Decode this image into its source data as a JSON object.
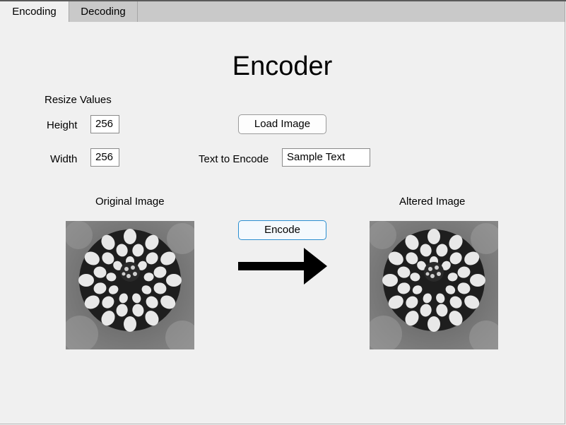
{
  "tabs": [
    {
      "label": "Encoding",
      "active": true
    },
    {
      "label": "Decoding",
      "active": false
    }
  ],
  "title": "Encoder",
  "resize": {
    "heading": "Resize Values",
    "height_label": "Height",
    "height_value": "256",
    "width_label": "Width",
    "width_value": "256"
  },
  "load_image_label": "Load Image",
  "text_to_encode": {
    "label": "Text to Encode",
    "value": "Sample Text"
  },
  "original_image_label": "Original Image",
  "altered_image_label": "Altered Image",
  "encode_label": "Encode",
  "colors": {
    "background": "#f0f0f0",
    "tab_bar": "#c9c9c9",
    "focus_border": "#2b8fd1"
  },
  "icons": {
    "arrow": "right-arrow-icon",
    "images": "dahlia-flower-grayscale"
  }
}
